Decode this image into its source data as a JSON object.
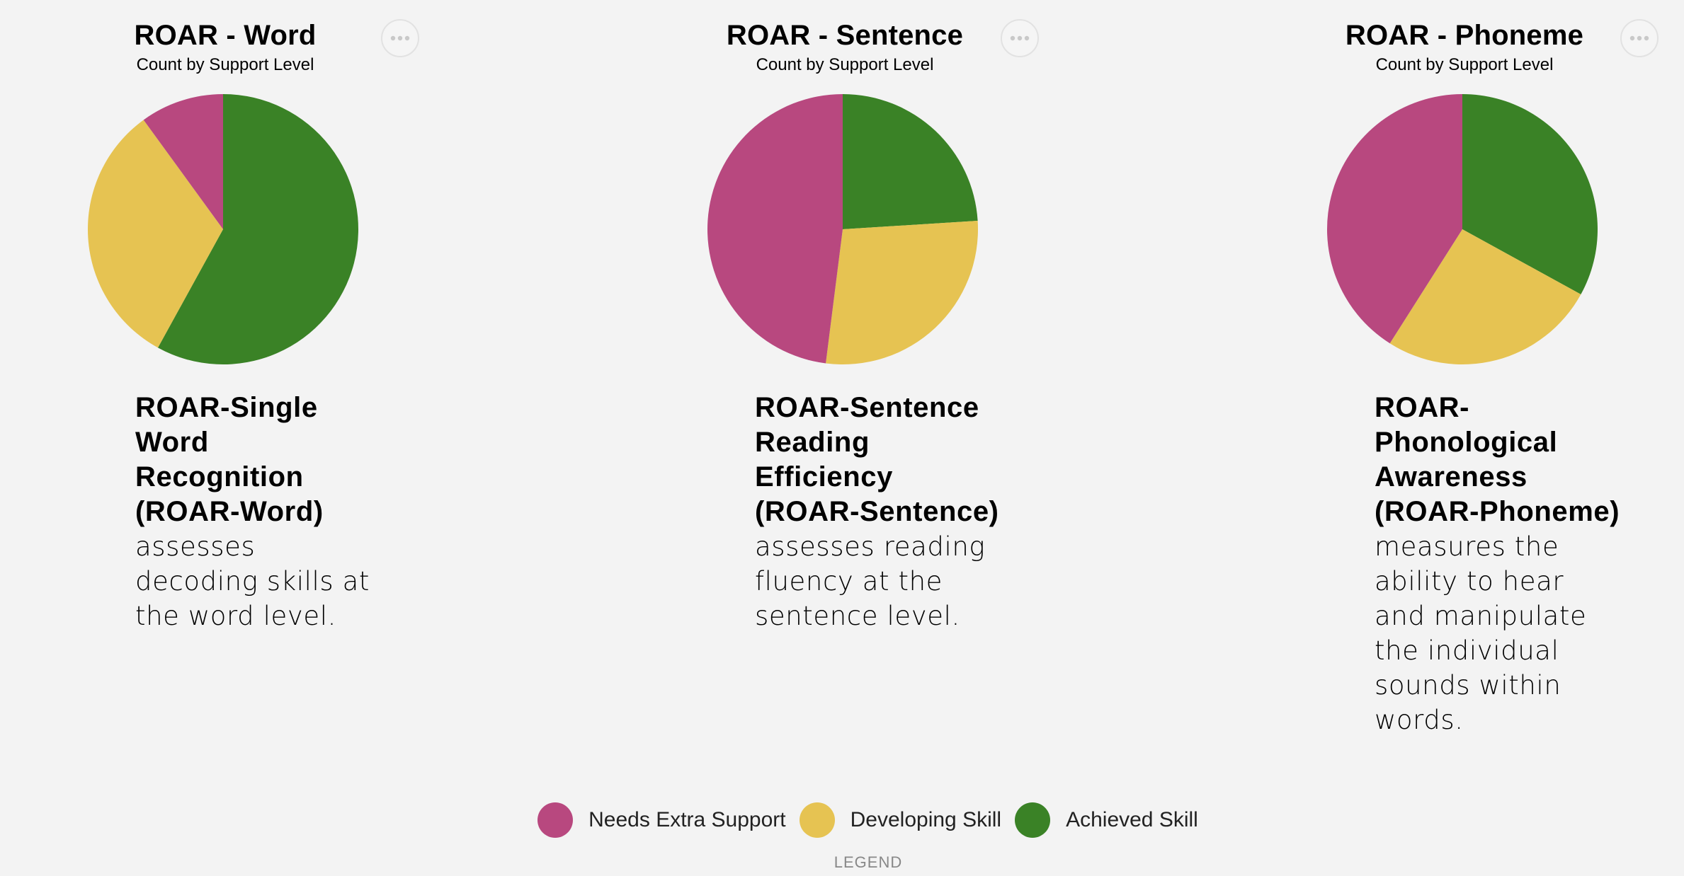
{
  "colors": {
    "needs_extra_support": "#b8487f",
    "developing_skill": "#e6c352",
    "achieved_skill": "#3a8226",
    "background": "#f3f3f3"
  },
  "icons": {
    "menu": "ellipsis-icon"
  },
  "chart_data": [
    {
      "type": "pie",
      "title": "ROAR - Word",
      "subtitle": "Count by Support Level",
      "categories": [
        "Needs Extra Support",
        "Developing Skill",
        "Achieved Skill"
      ],
      "values": [
        10,
        32,
        58
      ],
      "start_angle_deg": 0,
      "order": [
        "Achieved Skill",
        "Developing Skill",
        "Needs Extra Support"
      ]
    },
    {
      "type": "pie",
      "title": "ROAR - Sentence",
      "subtitle": "Count by Support Level",
      "categories": [
        "Needs Extra Support",
        "Developing Skill",
        "Achieved Skill"
      ],
      "values": [
        48,
        28,
        24
      ],
      "start_angle_deg": 0,
      "order": [
        "Achieved Skill",
        "Developing Skill",
        "Needs Extra Support"
      ]
    },
    {
      "type": "pie",
      "title": "ROAR - Phoneme",
      "subtitle": "Count by Support Level",
      "categories": [
        "Needs Extra Support",
        "Developing Skill",
        "Achieved Skill"
      ],
      "values": [
        41,
        26,
        33
      ],
      "start_angle_deg": 0,
      "order": [
        "Achieved Skill",
        "Developing Skill",
        "Needs Extra Support"
      ]
    }
  ],
  "descriptions": [
    {
      "name": "ROAR-Single Word Recognition (ROAR-Word)",
      "blurb": "assesses decoding skills at the word level."
    },
    {
      "name": "ROAR-Sentence Reading Efficiency (ROAR-Sentence)",
      "blurb": "assesses reading fluency at the sentence level."
    },
    {
      "name": "ROAR-Phonological Awareness (ROAR-Phoneme)",
      "blurb": "measures the ability to hear and manipulate the individual sounds within words."
    }
  ],
  "legend": {
    "title": "LEGEND",
    "items": [
      {
        "label": "Needs Extra Support",
        "color": "#b8487f"
      },
      {
        "label": "Developing Skill",
        "color": "#e6c352"
      },
      {
        "label": "Achieved Skill",
        "color": "#3a8226"
      }
    ]
  }
}
